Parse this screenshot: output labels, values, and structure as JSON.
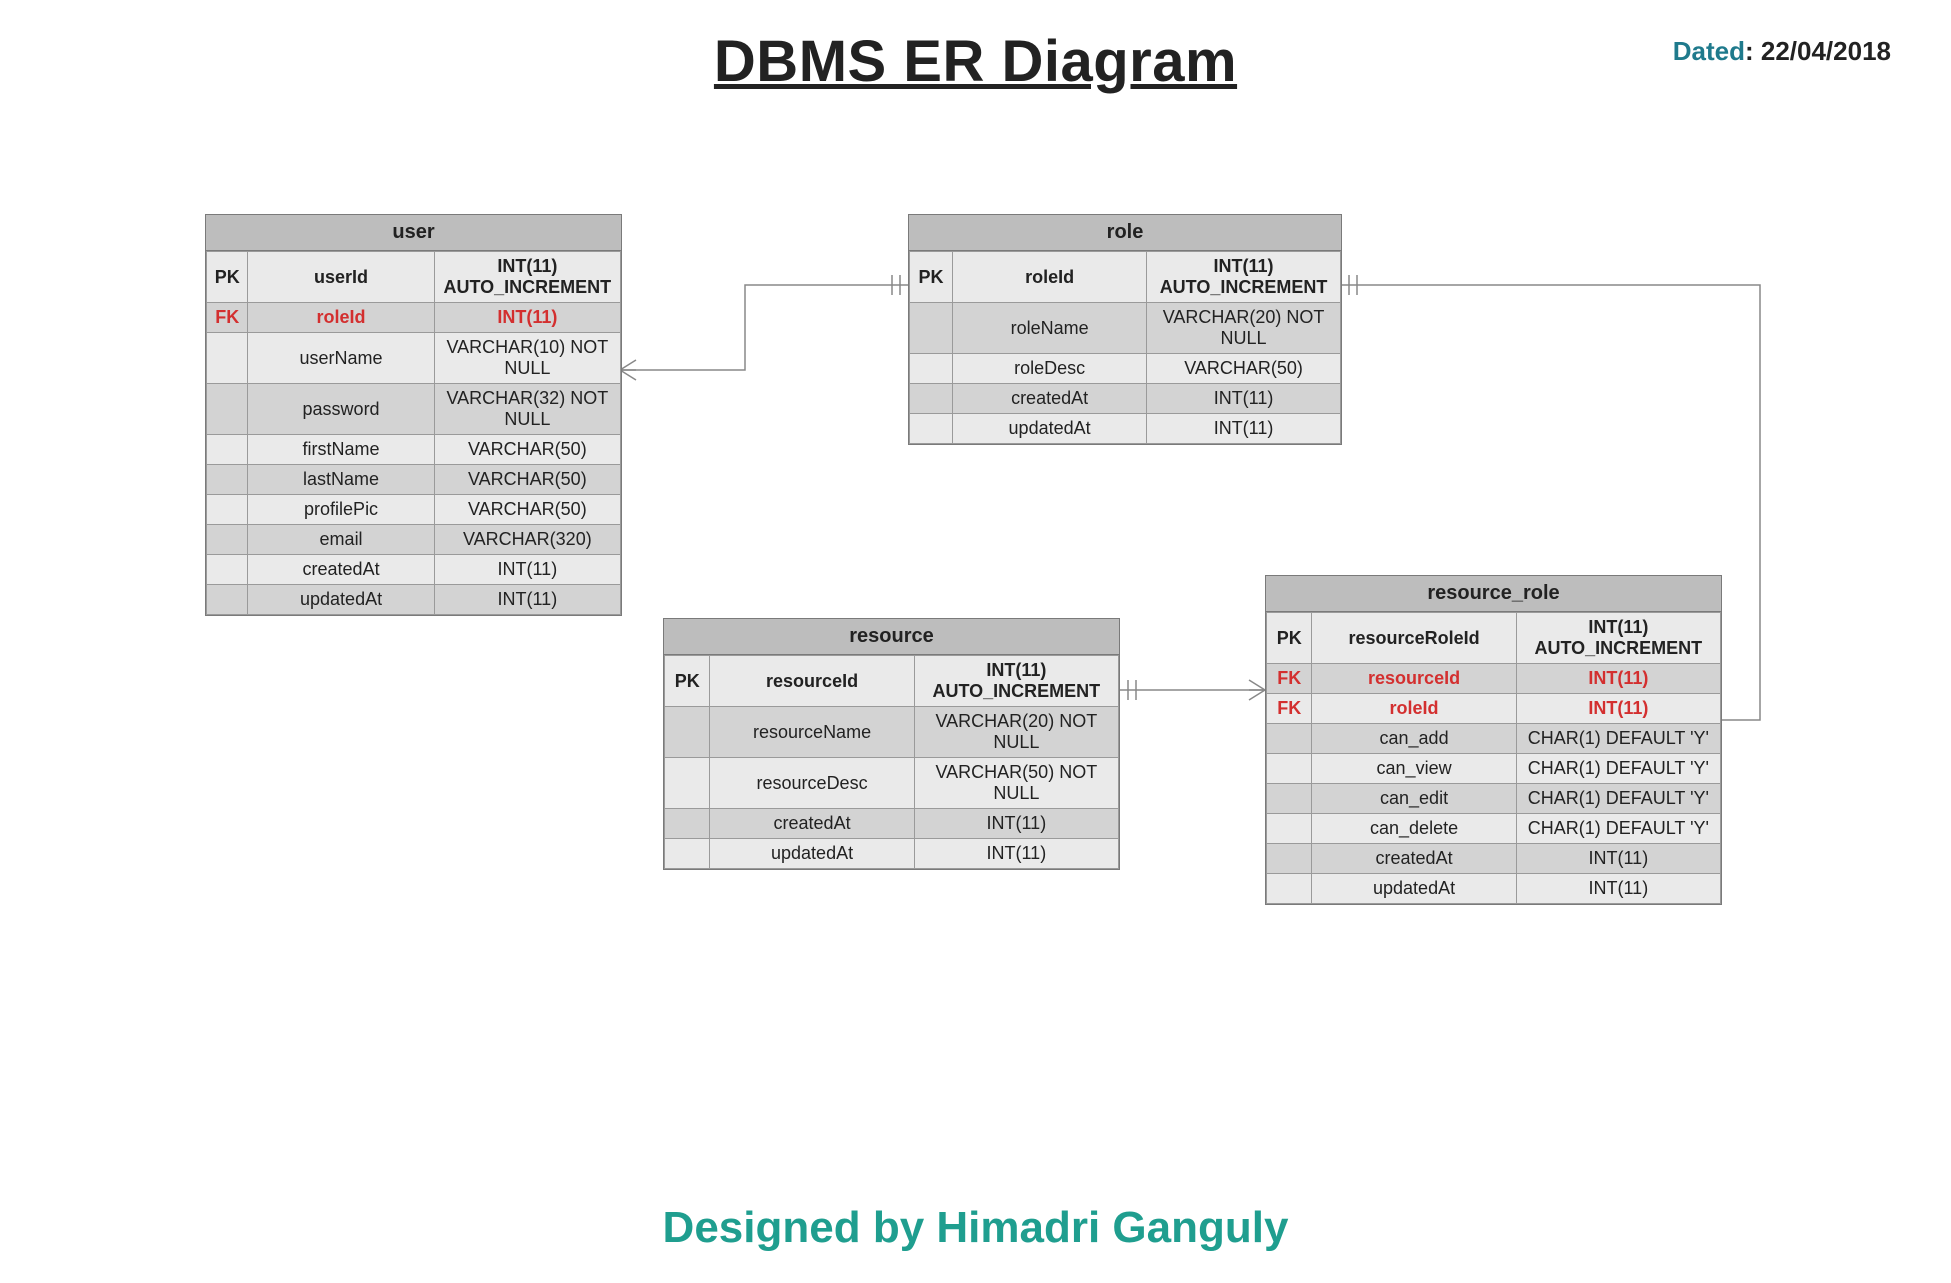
{
  "title": "DBMS ER Diagram",
  "dated_label": "Dated",
  "dated_value": "22/04/2018",
  "footer": "Designed by Himadri Ganguly",
  "entities": {
    "user": {
      "name": "user",
      "rows": [
        {
          "key": "PK",
          "name": "userId",
          "type": "INT(11) AUTO_INCREMENT",
          "fk": false
        },
        {
          "key": "FK",
          "name": "roleId",
          "type": "INT(11)",
          "fk": true
        },
        {
          "key": "",
          "name": "userName",
          "type": "VARCHAR(10) NOT NULL",
          "fk": false
        },
        {
          "key": "",
          "name": "password",
          "type": "VARCHAR(32) NOT NULL",
          "fk": false
        },
        {
          "key": "",
          "name": "firstName",
          "type": "VARCHAR(50)",
          "fk": false
        },
        {
          "key": "",
          "name": "lastName",
          "type": "VARCHAR(50)",
          "fk": false
        },
        {
          "key": "",
          "name": "profilePic",
          "type": "VARCHAR(50)",
          "fk": false
        },
        {
          "key": "",
          "name": "email",
          "type": "VARCHAR(320)",
          "fk": false
        },
        {
          "key": "",
          "name": "createdAt",
          "type": "INT(11)",
          "fk": false
        },
        {
          "key": "",
          "name": "updatedAt",
          "type": "INT(11)",
          "fk": false
        }
      ]
    },
    "role": {
      "name": "role",
      "rows": [
        {
          "key": "PK",
          "name": "roleId",
          "type": "INT(11) AUTO_INCREMENT",
          "fk": false
        },
        {
          "key": "",
          "name": "roleName",
          "type": "VARCHAR(20) NOT NULL",
          "fk": false
        },
        {
          "key": "",
          "name": "roleDesc",
          "type": "VARCHAR(50)",
          "fk": false
        },
        {
          "key": "",
          "name": "createdAt",
          "type": "INT(11)",
          "fk": false
        },
        {
          "key": "",
          "name": "updatedAt",
          "type": "INT(11)",
          "fk": false
        }
      ]
    },
    "resource": {
      "name": "resource",
      "rows": [
        {
          "key": "PK",
          "name": "resourceId",
          "type": "INT(11) AUTO_INCREMENT",
          "fk": false
        },
        {
          "key": "",
          "name": "resourceName",
          "type": "VARCHAR(20) NOT NULL",
          "fk": false
        },
        {
          "key": "",
          "name": "resourceDesc",
          "type": "VARCHAR(50) NOT NULL",
          "fk": false
        },
        {
          "key": "",
          "name": "createdAt",
          "type": "INT(11)",
          "fk": false
        },
        {
          "key": "",
          "name": "updatedAt",
          "type": "INT(11)",
          "fk": false
        }
      ]
    },
    "resource_role": {
      "name": "resource_role",
      "rows": [
        {
          "key": "PK",
          "name": "resourceRoleId",
          "type": "INT(11) AUTO_INCREMENT",
          "fk": false
        },
        {
          "key": "FK",
          "name": "resourceId",
          "type": "INT(11)",
          "fk": true
        },
        {
          "key": "FK",
          "name": "roleId",
          "type": "INT(11)",
          "fk": true
        },
        {
          "key": "",
          "name": "can_add",
          "type": "CHAR(1) DEFAULT 'Y'",
          "fk": false
        },
        {
          "key": "",
          "name": "can_view",
          "type": "CHAR(1) DEFAULT 'Y'",
          "fk": false
        },
        {
          "key": "",
          "name": "can_edit",
          "type": "CHAR(1) DEFAULT 'Y'",
          "fk": false
        },
        {
          "key": "",
          "name": "can_delete",
          "type": "CHAR(1) DEFAULT 'Y'",
          "fk": false
        },
        {
          "key": "",
          "name": "createdAt",
          "type": "INT(11)",
          "fk": false
        },
        {
          "key": "",
          "name": "updatedAt",
          "type": "INT(11)",
          "fk": false
        }
      ]
    }
  },
  "relationships": [
    {
      "from": "user.roleId",
      "to": "role.roleId",
      "cardinality": "many-to-one"
    },
    {
      "from": "resource_role.roleId",
      "to": "role.roleId",
      "cardinality": "many-to-one"
    },
    {
      "from": "resource_role.resourceId",
      "to": "resource.resourceId",
      "cardinality": "many-to-one"
    }
  ]
}
